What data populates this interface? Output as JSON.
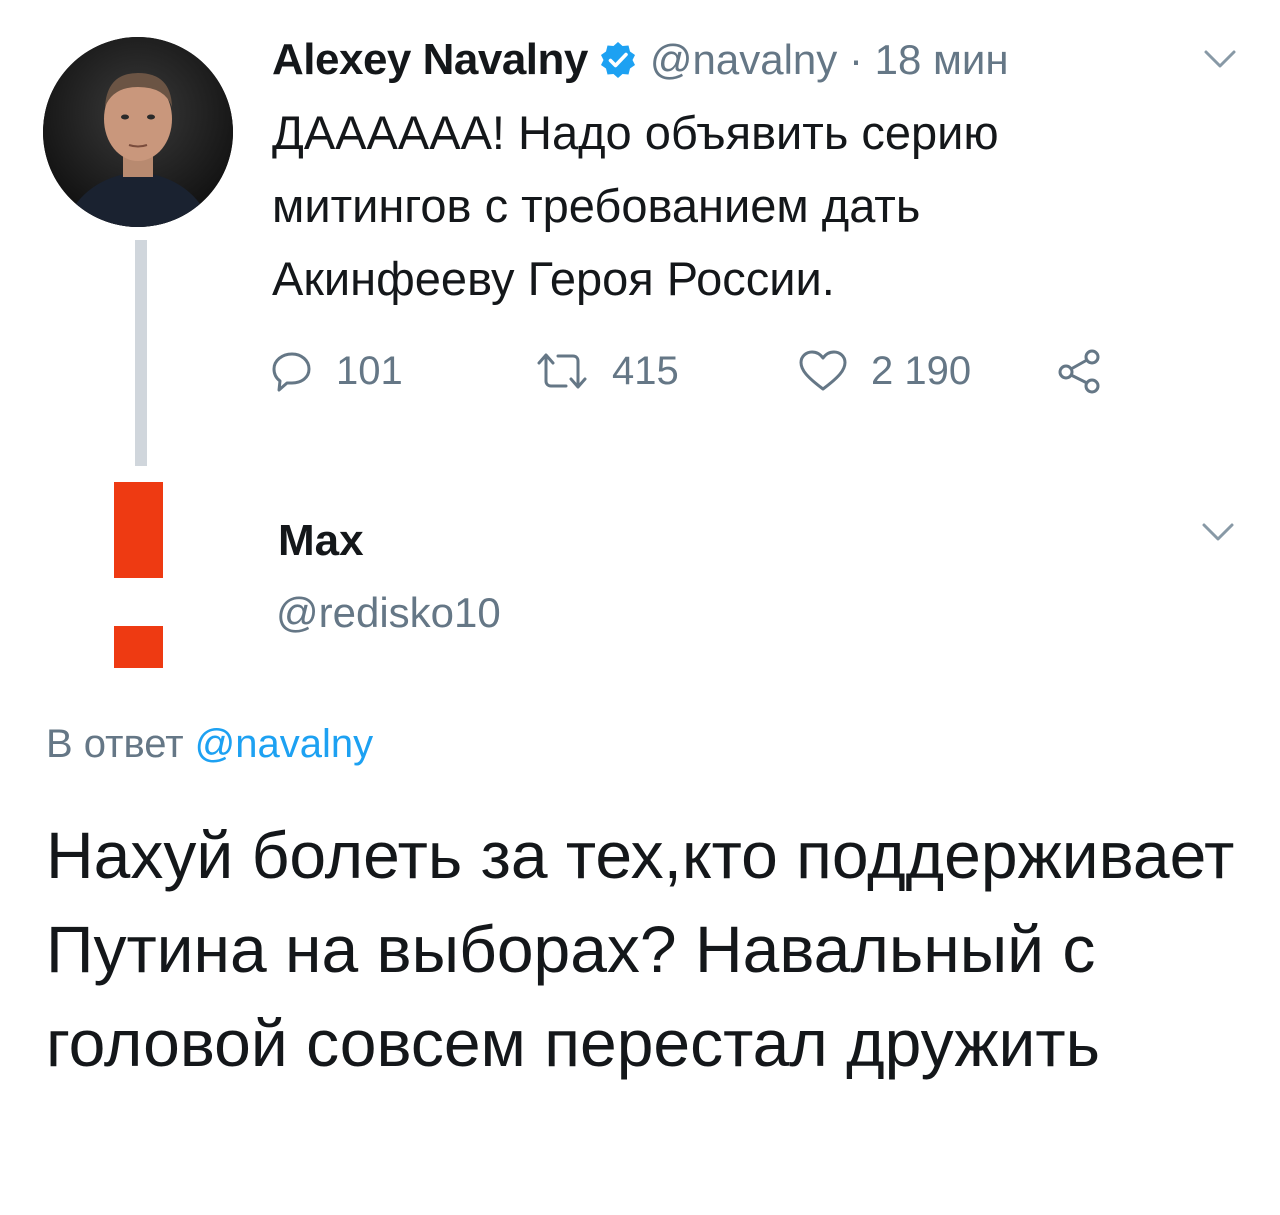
{
  "parent_tweet": {
    "display_name": "Alexey Navalny",
    "handle": "@navalny",
    "time": "18 мин",
    "text": "ДАААААА! Надо объявить серию митингов с требованием дать Акинфееву Героя России.",
    "actions": {
      "replies": "101",
      "retweets": "415",
      "likes": "2 190"
    }
  },
  "reply_tweet": {
    "display_name": "Max",
    "handle": "@redisko10",
    "reply_to_prefix": "В ответ",
    "reply_to_handle": "@navalny",
    "text": "Нахуй болеть за тех,кто поддерживает Путина на выборах? Навальный с головой совсем перестал дружить"
  },
  "colors": {
    "text": "#14171a",
    "secondary": "#657786",
    "link": "#1da1f2",
    "verified": "#1da1f2",
    "thread_line": "#d0d6dc",
    "exclamation": "#ee3a12"
  },
  "icons": {
    "verified": "verified-badge-icon",
    "caret": "chevron-down-icon",
    "reply": "reply-icon",
    "retweet": "retweet-icon",
    "like": "heart-icon",
    "share": "share-icon"
  }
}
